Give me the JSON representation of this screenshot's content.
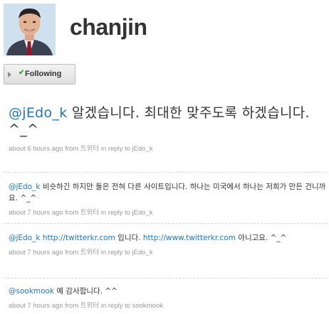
{
  "profile": {
    "screen_name": "chanjin",
    "avatar": "avatar-photo"
  },
  "follow_button": {
    "label": "Following",
    "icon": "checkmark-icon"
  },
  "statuses": [
    {
      "mention": "@jEdo_k",
      "body": " 알겠습니다. 최대한 맞주도록 하겠습니다. ^_^",
      "time": "about 6 hours ago",
      "from_word": "from",
      "source": "트위터",
      "reply_to": "in reply to jEdo_k"
    },
    {
      "mention": "@jEdo_k",
      "body": " 비슷하긴 하지만 둘은 전혀 다른 사이트입니다. 하나는 미국에서 하나는 저희가 만든 건니까요. ^_^",
      "time": "about 7 hours ago",
      "from_word": "from",
      "source": "트위터",
      "reply_to": "in reply to jEdo_k"
    },
    {
      "mention": "@jEdo_k",
      "link1": "http://twitterkr.com",
      "middle": " 입니다. ",
      "link2": "http://www.twitterkr.com",
      "end": " 아니고요. ^_^",
      "time": "about 7 hours ago",
      "from_word": "from",
      "source": "트위터",
      "reply_to": "in reply to jEdo_k"
    },
    {
      "mention": "@sookmook",
      "body": " 예 감사합니다. ^^",
      "time": "about 7 hours ago",
      "from_word": "from",
      "source": "트위터",
      "reply_to": "in reply to sookmook"
    }
  ]
}
